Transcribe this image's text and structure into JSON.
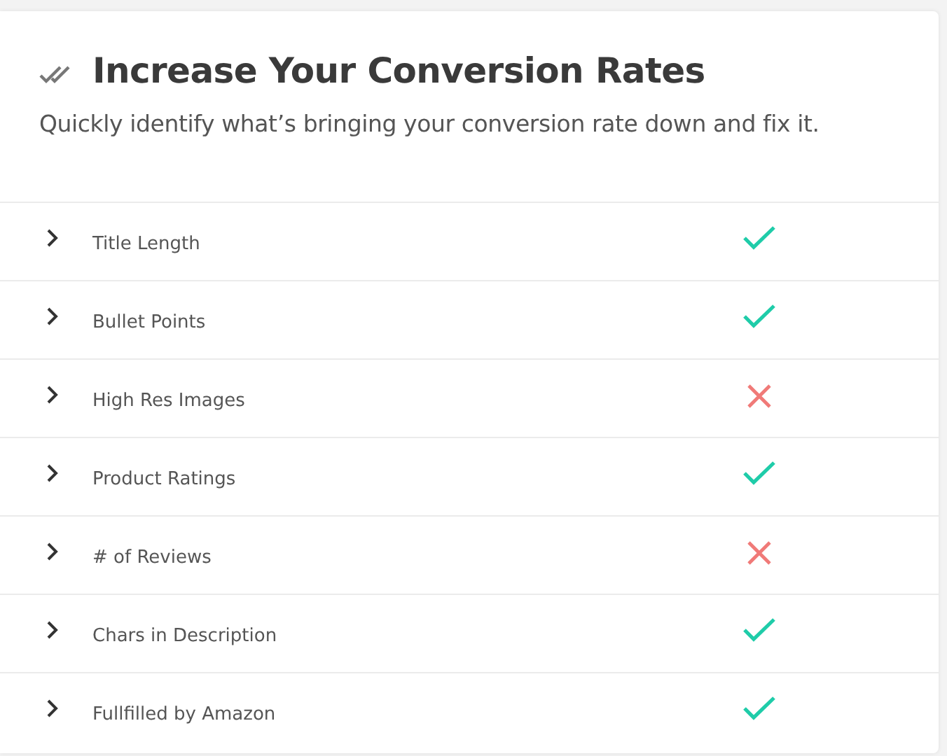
{
  "header": {
    "title": "Increase Your Conversion Rates",
    "subtitle": "Quickly identify what’s bringing your conversion rate down and fix it."
  },
  "checks": [
    {
      "label": "Title Length",
      "passed": true
    },
    {
      "label": "Bullet Points",
      "passed": true
    },
    {
      "label": "High Res Images",
      "passed": false
    },
    {
      "label": "Product Ratings",
      "passed": true
    },
    {
      "label": "# of Reviews",
      "passed": false
    },
    {
      "label": "Chars in Description",
      "passed": true
    },
    {
      "label": "Fullfilled by Amazon",
      "passed": true
    }
  ]
}
